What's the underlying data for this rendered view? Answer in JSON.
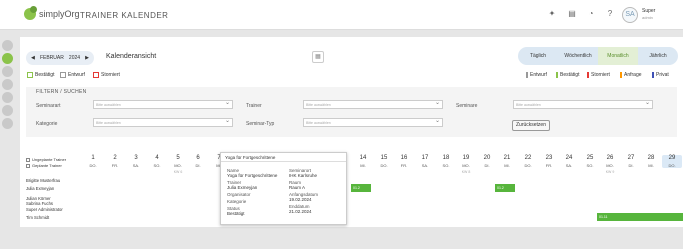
{
  "app": {
    "logo_text": "simplyOrg",
    "title": "TRAINER KALENDER"
  },
  "user": {
    "name": "Super",
    "sub": "admin",
    "avatar_initials": "SA"
  },
  "toolbar": {
    "prev_icon": "◀",
    "next_icon": "▶",
    "month": "FEBRUAR",
    "year": "2024",
    "view_title": "Kalenderansicht",
    "views": [
      "Täglich",
      "Wöchentlich",
      "Monatlich",
      "Jährlich"
    ],
    "active_view": "Monatlich"
  },
  "top_icons": [
    "lightbulb-icon",
    "book-icon",
    "bell-icon",
    "help-icon"
  ],
  "legend_left": [
    {
      "label": "Bestätigt",
      "color": "#8bc34a"
    },
    {
      "label": "Entwurf",
      "color": "#999999"
    },
    {
      "label": "Storniert",
      "color": "#e53935"
    }
  ],
  "legend_right": [
    {
      "label": "Entwurf",
      "color": "#999999"
    },
    {
      "label": "Bestätigt",
      "color": "#8bc34a"
    },
    {
      "label": "Storniert",
      "color": "#e53935"
    },
    {
      "label": "Anfrage",
      "color": "#ff9800"
    },
    {
      "label": "Privat",
      "color": "#3f51b5"
    }
  ],
  "filter": {
    "title": "FILTERN / SUCHEN",
    "labels": {
      "seminarart": "Seminarart",
      "trainer": "Trainer",
      "seminare": "Seminare",
      "kategorie": "Kategorie",
      "seminar_typ": "Seminar-Typ"
    },
    "placeholder": "Bitte auswählen",
    "reset": "Zurücksetzen"
  },
  "calendar": {
    "highlight_legend": [
      "Ungeplante Trainer",
      "Geplante Trainer"
    ],
    "days": [
      {
        "n": "1",
        "w": "DO."
      },
      {
        "n": "2",
        "w": "FR."
      },
      {
        "n": "3",
        "w": "SA."
      },
      {
        "n": "4",
        "w": "SO."
      },
      {
        "n": "5",
        "w": "MO.",
        "kw": "KW 6"
      },
      {
        "n": "6",
        "w": "DI."
      },
      {
        "n": "7",
        "w": "MI."
      },
      {
        "n": "14",
        "w": "MI."
      },
      {
        "n": "15",
        "w": "DO."
      },
      {
        "n": "16",
        "w": "FR."
      },
      {
        "n": "17",
        "w": "SA."
      },
      {
        "n": "18",
        "w": "SO."
      },
      {
        "n": "19",
        "w": "MO.",
        "kw": "KW 8"
      },
      {
        "n": "20",
        "w": "DI."
      },
      {
        "n": "21",
        "w": "MI."
      },
      {
        "n": "22",
        "w": "DO."
      },
      {
        "n": "23",
        "w": "FR."
      },
      {
        "n": "24",
        "w": "SA."
      },
      {
        "n": "25",
        "w": "SO."
      },
      {
        "n": "26",
        "w": "MO.",
        "kw": "KW 9"
      },
      {
        "n": "27",
        "w": "DI."
      },
      {
        "n": "28",
        "w": "MI."
      },
      {
        "n": "29",
        "w": "DO."
      }
    ],
    "trainers": [
      "Brigitte Musterfrau",
      "Julia Exmeyjan",
      "Julian Körner",
      "Sabrina Fuchs",
      "Super Administrator",
      "Tim Schmidt"
    ],
    "events": [
      "01.2",
      "01.2",
      "01.11"
    ]
  },
  "tooltip": {
    "title": "Yoga für Fortgeschrittene",
    "left": [
      {
        "k": "Name",
        "v": "Yoga für Fortgeschrittene"
      },
      {
        "k": "Trainer",
        "v": "Julia Exmeyjan"
      },
      {
        "k": "Organisator",
        "v": ""
      },
      {
        "k": "Kategorie",
        "v": ""
      },
      {
        "k": "Status",
        "v": "Bestätigt"
      }
    ],
    "right": [
      {
        "k": "Seminarort",
        "v": "IHK Karlsruhe"
      },
      {
        "k": "Raum",
        "v": "Raum A"
      },
      {
        "k": "Anfangsdatum",
        "v": "19.02.2024"
      },
      {
        "k": "Enddatum",
        "v": "21.02.2024"
      }
    ]
  }
}
